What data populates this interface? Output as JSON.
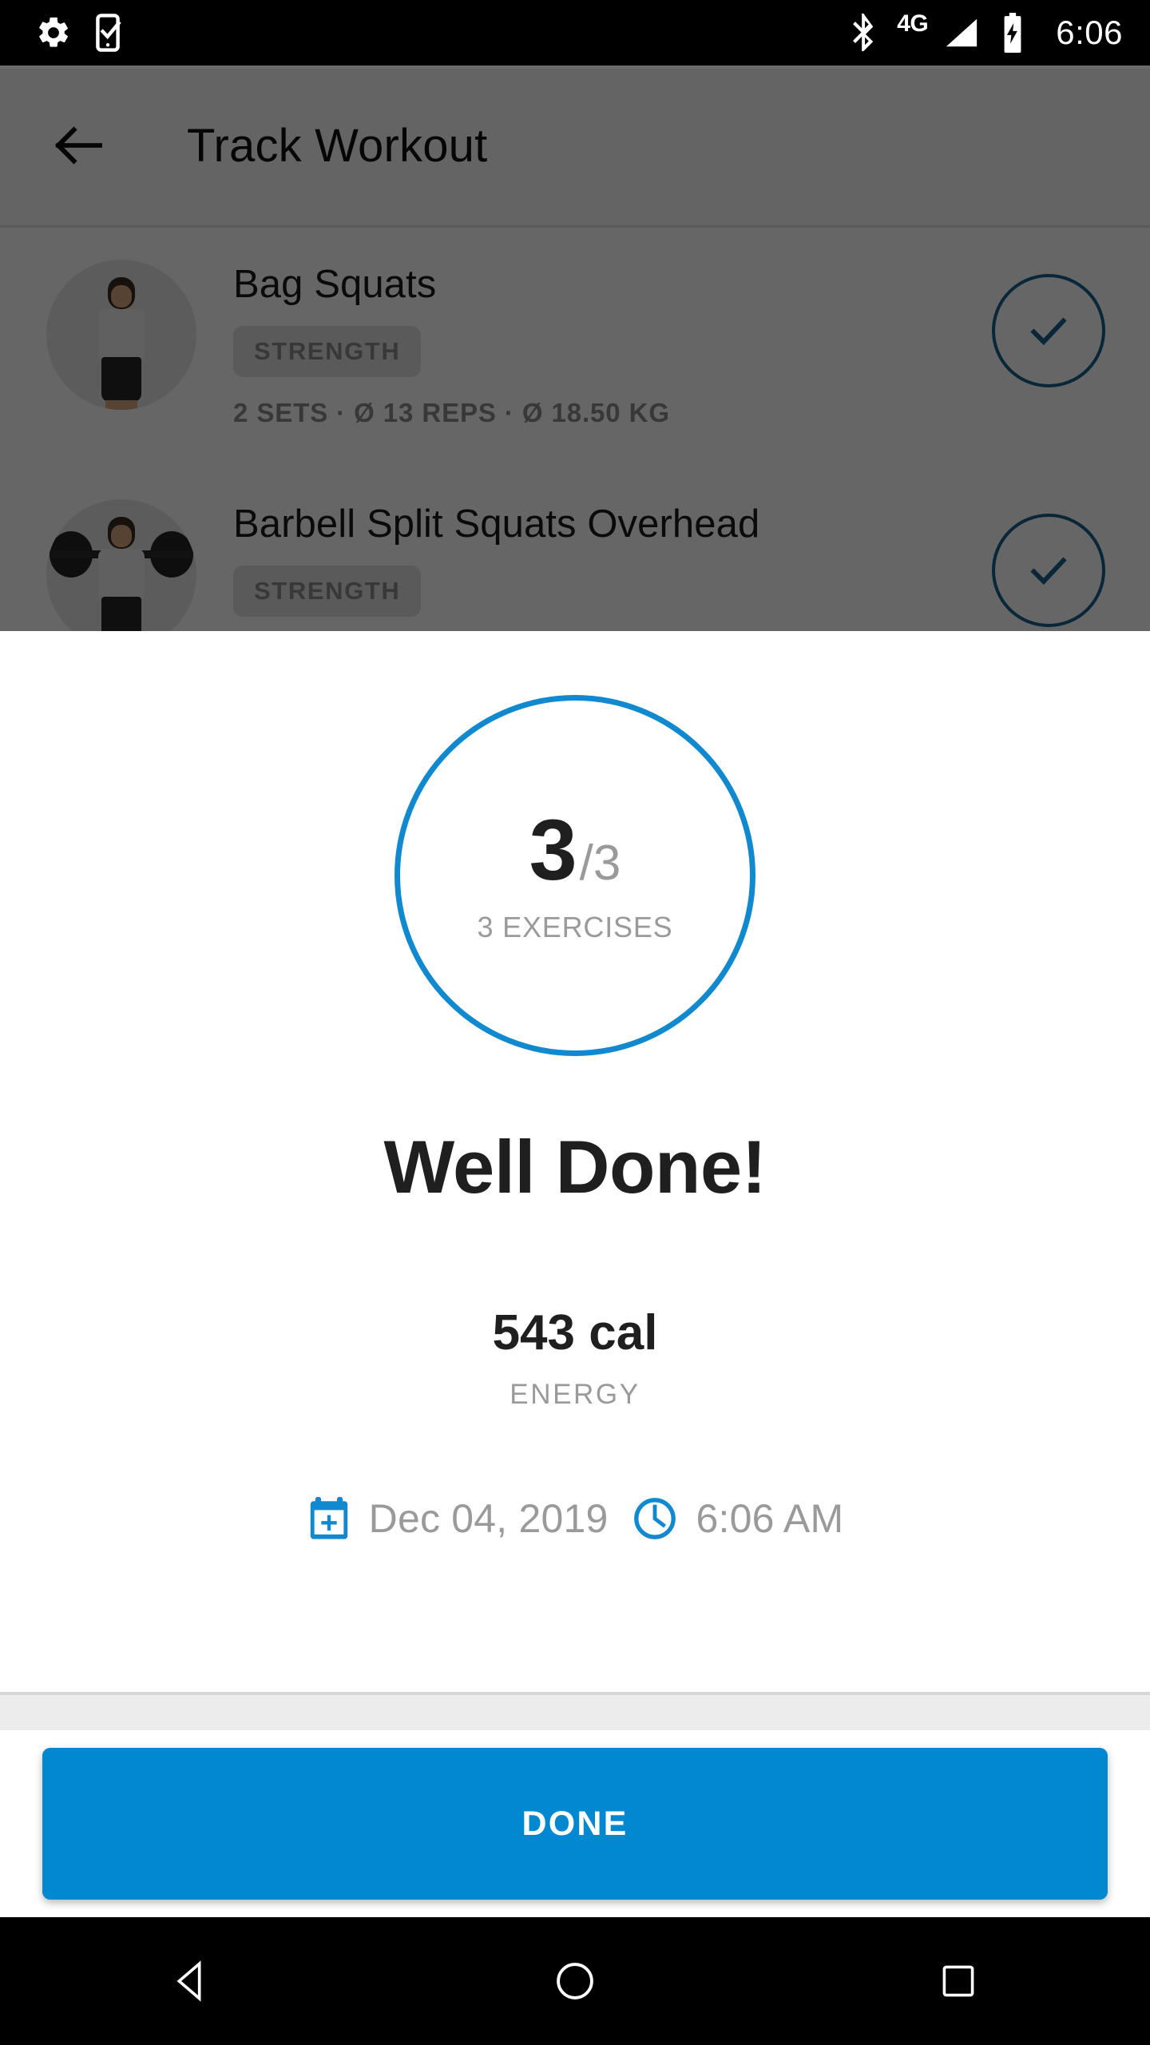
{
  "status_bar": {
    "time": "6:06",
    "left_icons": [
      "settings-gear-icon",
      "phone-check-icon"
    ],
    "right_icons": [
      "bluetooth-icon",
      "cellular-signal-icon",
      "battery-charging-icon"
    ],
    "network_label": "4G"
  },
  "app_bar": {
    "back_icon": "back-arrow-icon",
    "title": "Track Workout"
  },
  "exercise_list": [
    {
      "name": "Bag Squats",
      "badge": "STRENGTH",
      "stats": "2 SETS · Ø 13 REPS · Ø 18.50 KG",
      "completed": true
    },
    {
      "name": "Barbell Split Squats Overhead",
      "badge": "STRENGTH",
      "stats": "",
      "completed": true
    }
  ],
  "summary_sheet": {
    "ring": {
      "completed": "3",
      "total": "/3",
      "label": "3 EXERCISES"
    },
    "headline": "Well Done!",
    "energy": {
      "value": "543 cal",
      "label": "ENERGY"
    },
    "date": {
      "icon": "calendar-plus-icon",
      "text": "Dec 04, 2019"
    },
    "time": {
      "icon": "clock-icon",
      "text": "6:06 AM"
    },
    "done_label": "DONE"
  },
  "nav_bar": {
    "back": "nav-back-icon",
    "home": "nav-home-icon",
    "recents": "nav-recents-icon"
  },
  "colors": {
    "accent_blue": "#1089ce",
    "button_blue": "#0288d1",
    "scrim": "#666666",
    "muted_text": "#9a9a9a",
    "dark_text": "#1f1f1f"
  }
}
